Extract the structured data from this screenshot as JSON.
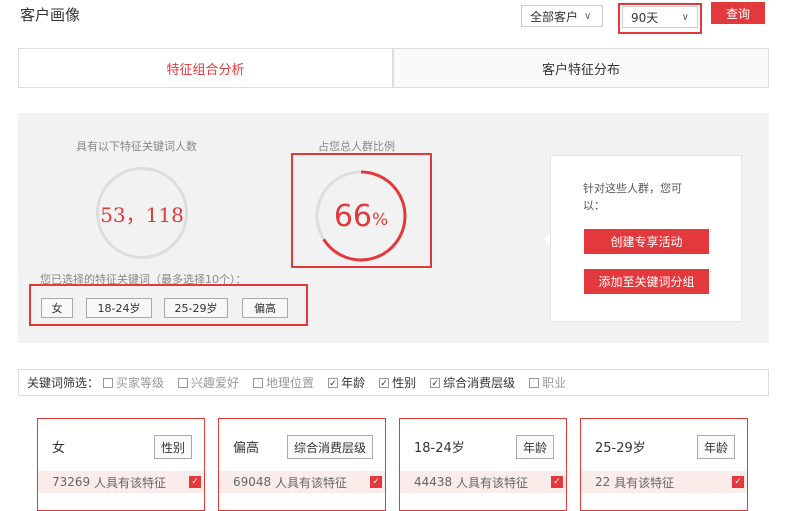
{
  "header": {
    "title": "客户画像",
    "customer_select": "全部客户",
    "days_select": "90天",
    "query_button": "查询"
  },
  "tabs": [
    {
      "label": "特征组合分析",
      "active": true
    },
    {
      "label": "客户特征分布",
      "active": false
    }
  ],
  "analysis": {
    "count_label": "具有以下特征关键词人数",
    "count_value": "53，118",
    "ratio_label": "占您总人群比例",
    "ratio_value": "66",
    "ratio_unit": "%",
    "ratio_fraction": 0.66,
    "selected_label": "您已选择的特征关键词（最多选择10个）：",
    "selected_tags": [
      "女",
      "18-24岁",
      "25-29岁",
      "偏高"
    ],
    "action_title": "针对这些人群，您可以：",
    "action_create": "创建专享活动",
    "action_add": "添加至关键词分组"
  },
  "filter": {
    "label": "关键词筛选：",
    "items": [
      {
        "label": "买家等级",
        "checked": false
      },
      {
        "label": "兴趣爱好",
        "checked": false
      },
      {
        "label": "地理位置",
        "checked": false
      },
      {
        "label": "年龄",
        "checked": true
      },
      {
        "label": "性别",
        "checked": true
      },
      {
        "label": "综合消费层级",
        "checked": true
      },
      {
        "label": "职业",
        "checked": false
      }
    ]
  },
  "cards": [
    {
      "name": "女",
      "category": "性别",
      "count": "73269",
      "suffix": "人具有该特征"
    },
    {
      "name": "偏高",
      "category": "综合消费层级",
      "count": "69048",
      "suffix": "人具有该特征"
    },
    {
      "name": "18-24岁",
      "category": "年龄",
      "count": "44438",
      "suffix": "人具有该特征"
    },
    {
      "name": "25-29岁",
      "category": "年龄",
      "count": "22",
      "suffix": "具有该特征"
    }
  ],
  "colors": {
    "accent": "#e4393c",
    "panel_bg": "#f2f2f2"
  }
}
